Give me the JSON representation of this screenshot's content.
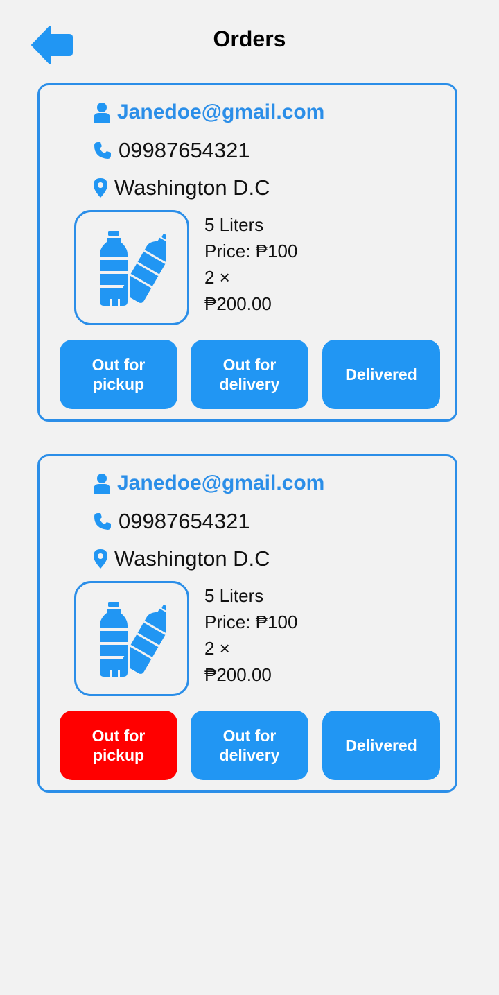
{
  "header": {
    "title": "Orders",
    "back_icon": "arrow-left-icon"
  },
  "colors": {
    "accent": "#2196f3",
    "border": "#2b8ee8",
    "active": "#ff0000",
    "background": "#f2f2f2"
  },
  "orders": [
    {
      "email": "Janedoe@gmail.com",
      "phone": "09987654321",
      "address": "Washington D.C",
      "product": {
        "volume": "5 Liters",
        "price": "Price: ₱100",
        "quantity": "2 ×",
        "total": "₱200.00"
      },
      "buttons": {
        "pickup": "Out for pickup",
        "delivery": "Out for delivery",
        "delivered": "Delivered"
      },
      "active_status": "none"
    },
    {
      "email": "Janedoe@gmail.com",
      "phone": "09987654321",
      "address": "Washington D.C",
      "product": {
        "volume": "5 Liters",
        "price": "Price: ₱100",
        "quantity": "2 ×",
        "total": "₱200.00"
      },
      "buttons": {
        "pickup": "Out for pickup",
        "delivery": "Out for delivery",
        "delivered": "Delivered"
      },
      "active_status": "pickup"
    }
  ]
}
